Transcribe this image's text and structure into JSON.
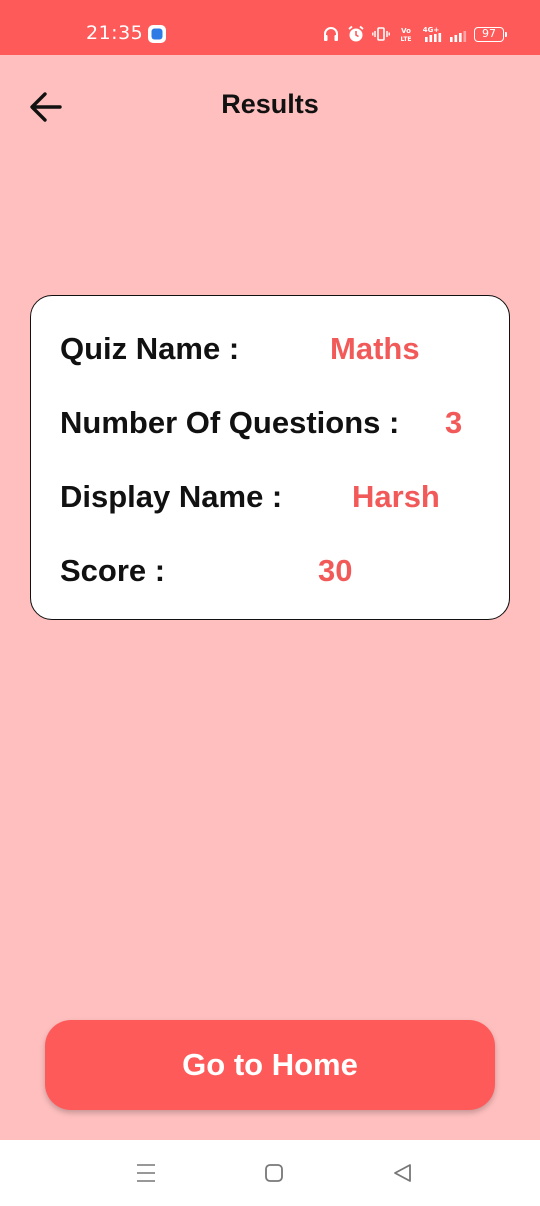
{
  "status_bar": {
    "time": "21:35",
    "battery": "97",
    "network": "4G+",
    "volte": "Vo LTE",
    "icons": [
      "app-notification-icon",
      "headphones-icon",
      "alarm-icon",
      "vibrate-icon",
      "volte-icon",
      "signal-4g-icon",
      "signal-icon",
      "battery-icon"
    ]
  },
  "header": {
    "title": "Results",
    "back_icon": "arrow-left-icon"
  },
  "result": {
    "rows": [
      {
        "label": "Quiz Name :",
        "value": "Maths"
      },
      {
        "label": "Number Of Questions :",
        "value": "3"
      },
      {
        "label": "Display Name :",
        "value": "Harsh"
      },
      {
        "label": "Score :",
        "value": "30"
      }
    ]
  },
  "actions": {
    "home_label": "Go to Home"
  },
  "nav": {
    "icons": [
      "menu-icon",
      "home-square-icon",
      "back-triangle-icon"
    ]
  },
  "colors": {
    "background": "#FFBFBF",
    "accent": "#FF5A5A",
    "value_text": "#F25A5A",
    "card": "#FFFFFF"
  }
}
